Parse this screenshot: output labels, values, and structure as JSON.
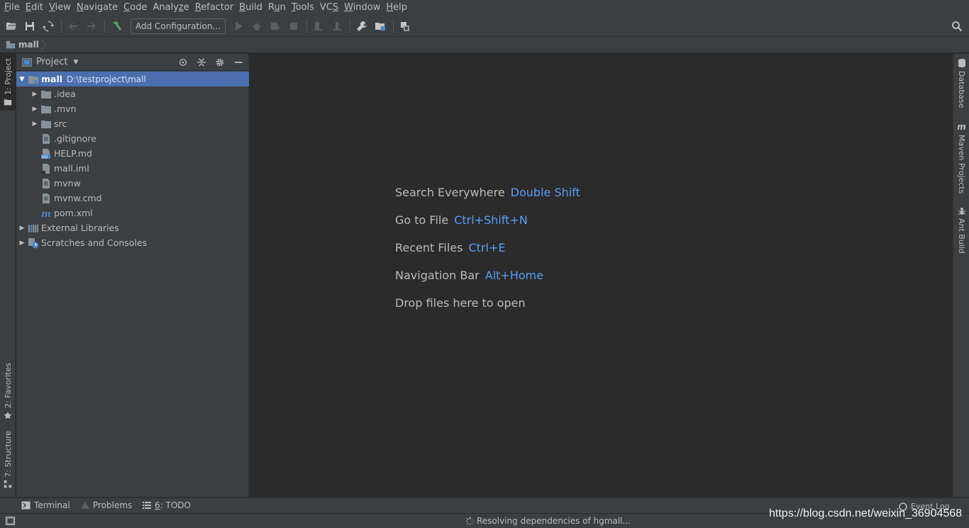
{
  "menubar": {
    "items": [
      {
        "mnemonic": "F",
        "rest": "ile"
      },
      {
        "mnemonic": "E",
        "rest": "dit"
      },
      {
        "mnemonic": "V",
        "rest": "iew"
      },
      {
        "mnemonic": "N",
        "rest": "avigate"
      },
      {
        "mnemonic": "C",
        "rest": "ode"
      },
      {
        "prefix": "Analy",
        "mnemonic": "z",
        "rest": "e"
      },
      {
        "mnemonic": "R",
        "rest": "efactor"
      },
      {
        "mnemonic": "B",
        "rest": "uild"
      },
      {
        "prefix": "R",
        "mnemonic": "u",
        "rest": "n"
      },
      {
        "mnemonic": "T",
        "rest": "ools"
      },
      {
        "prefix": "VC",
        "mnemonic": "S",
        "rest": ""
      },
      {
        "mnemonic": "W",
        "rest": "indow"
      },
      {
        "mnemonic": "H",
        "rest": "elp"
      }
    ]
  },
  "toolbar": {
    "add_config_label": "Add Configuration..."
  },
  "navbar": {
    "crumb": "mall"
  },
  "left_stripe": {
    "project_tab": "1: Project",
    "favorites_tab": "2: Favorites",
    "structure_tab": "7: Structure"
  },
  "right_stripe": {
    "database_tab": "Database",
    "maven_tab": "Maven Projects",
    "ant_tab": "Ant Build"
  },
  "project_panel": {
    "title": "Project",
    "root": {
      "name": "mall",
      "path": "D:\\testproject\\mall"
    },
    "items": [
      {
        "name": ".idea",
        "type": "folder"
      },
      {
        "name": ".mvn",
        "type": "folder"
      },
      {
        "name": "src",
        "type": "folder"
      },
      {
        "name": ".gitignore",
        "type": "file"
      },
      {
        "name": "HELP.md",
        "type": "md"
      },
      {
        "name": "mall.iml",
        "type": "iml"
      },
      {
        "name": "mvnw",
        "type": "file"
      },
      {
        "name": "mvnw.cmd",
        "type": "file"
      },
      {
        "name": "pom.xml",
        "type": "maven"
      }
    ],
    "external_libraries": "External Libraries",
    "scratches": "Scratches and Consoles"
  },
  "editor": {
    "hints": [
      {
        "label": "Search Everywhere",
        "shortcut": "Double Shift"
      },
      {
        "label": "Go to File",
        "shortcut": "Ctrl+Shift+N"
      },
      {
        "label": "Recent Files",
        "shortcut": "Ctrl+E"
      },
      {
        "label": "Navigation Bar",
        "shortcut": "Alt+Home"
      },
      {
        "label": "Drop files here to open",
        "shortcut": ""
      }
    ]
  },
  "bottom_bar": {
    "terminal": "Terminal",
    "problems": "Problems",
    "todo_mnemonic": "6",
    "todo_rest": ": TODO",
    "event_log": "Event Log"
  },
  "status_bar": {
    "text": "Resolving dependencies of hgmall..."
  },
  "watermark": "https://blog.csdn.net/weixin_36904568",
  "colors": {
    "background": "#2b2b2b",
    "panel": "#3c3f41",
    "selection": "#4b6eaf",
    "shortcut": "#589df6",
    "folder": "#87939a"
  }
}
